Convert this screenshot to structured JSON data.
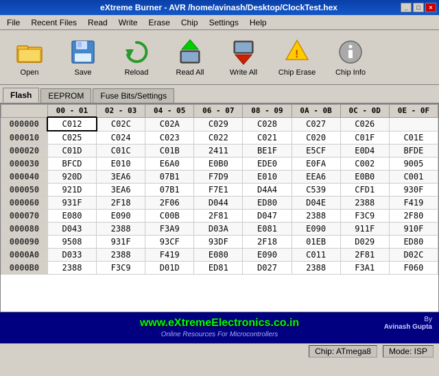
{
  "titlebar": {
    "title": "eXtreme Burner - AVR /home/avinash/Desktop/ClockTest.hex",
    "controls": [
      "_",
      "□",
      "×"
    ]
  },
  "menubar": {
    "items": [
      "File",
      "Recent Files",
      "Read",
      "Write",
      "Erase",
      "Chip",
      "Settings",
      "Help"
    ]
  },
  "toolbar": {
    "buttons": [
      {
        "label": "Open",
        "icon": "folder-icon"
      },
      {
        "label": "Save",
        "icon": "save-icon"
      },
      {
        "label": "Reload",
        "icon": "reload-icon"
      },
      {
        "label": "Read All",
        "icon": "read-icon"
      },
      {
        "label": "Write All",
        "icon": "write-icon"
      },
      {
        "label": "Chip Erase",
        "icon": "erase-icon"
      },
      {
        "label": "Chip Info",
        "icon": "info-icon"
      }
    ]
  },
  "tabs": {
    "items": [
      "Flash",
      "EEPROM",
      "Fuse Bits/Settings"
    ],
    "active": 0
  },
  "table": {
    "headers": [
      "",
      "00 - 01",
      "02 - 03",
      "04 - 05",
      "06 - 07",
      "08 - 09",
      "0A - 0B",
      "0C - 0D",
      "0E - 0F"
    ],
    "rows": [
      {
        "addr": "000000",
        "cells": [
          "C012",
          "C02C",
          "C02A",
          "C029",
          "C028",
          "C027",
          "C026",
          ""
        ]
      },
      {
        "addr": "000010",
        "cells": [
          "C025",
          "C024",
          "C023",
          "C022",
          "C021",
          "C020",
          "C01F",
          "C01E"
        ]
      },
      {
        "addr": "000020",
        "cells": [
          "C01D",
          "C01C",
          "C01B",
          "2411",
          "BE1F",
          "E5CF",
          "E0D4",
          "BFDE"
        ]
      },
      {
        "addr": "000030",
        "cells": [
          "BFCD",
          "E010",
          "E6A0",
          "E0B0",
          "EDE0",
          "E0FA",
          "C002",
          "9005"
        ]
      },
      {
        "addr": "000040",
        "cells": [
          "920D",
          "3EA6",
          "07B1",
          "F7D9",
          "E010",
          "EEA6",
          "E0B0",
          "C001"
        ]
      },
      {
        "addr": "000050",
        "cells": [
          "921D",
          "3EA6",
          "07B1",
          "F7E1",
          "D4A4",
          "C539",
          "CFD1",
          "930F"
        ]
      },
      {
        "addr": "000060",
        "cells": [
          "931F",
          "2F18",
          "2F06",
          "D044",
          "ED80",
          "D04E",
          "2388",
          "F419"
        ]
      },
      {
        "addr": "000070",
        "cells": [
          "E080",
          "E090",
          "C00B",
          "2F81",
          "D047",
          "2388",
          "F3C9",
          "2F80"
        ]
      },
      {
        "addr": "000080",
        "cells": [
          "D043",
          "2388",
          "F3A9",
          "D03A",
          "E081",
          "E090",
          "911F",
          "910F"
        ]
      },
      {
        "addr": "000090",
        "cells": [
          "9508",
          "931F",
          "93CF",
          "93DF",
          "2F18",
          "01EB",
          "D029",
          "ED80"
        ]
      },
      {
        "addr": "0000A0",
        "cells": [
          "D033",
          "2388",
          "F419",
          "E080",
          "E090",
          "C011",
          "2F81",
          "D02C"
        ]
      },
      {
        "addr": "0000B0",
        "cells": [
          "2388",
          "F3C9",
          "D01D",
          "ED81",
          "D027",
          "2388",
          "F3A1",
          "F060"
        ]
      }
    ]
  },
  "footer": {
    "url": "www.eXtremeElectronics.co.in",
    "tagline": "Online Resources For Microcontrollers",
    "by": "By",
    "author": "Avinash Gupta"
  },
  "statusbar": {
    "chip": "Chip: ATmega8",
    "mode": "Mode: ISP"
  }
}
